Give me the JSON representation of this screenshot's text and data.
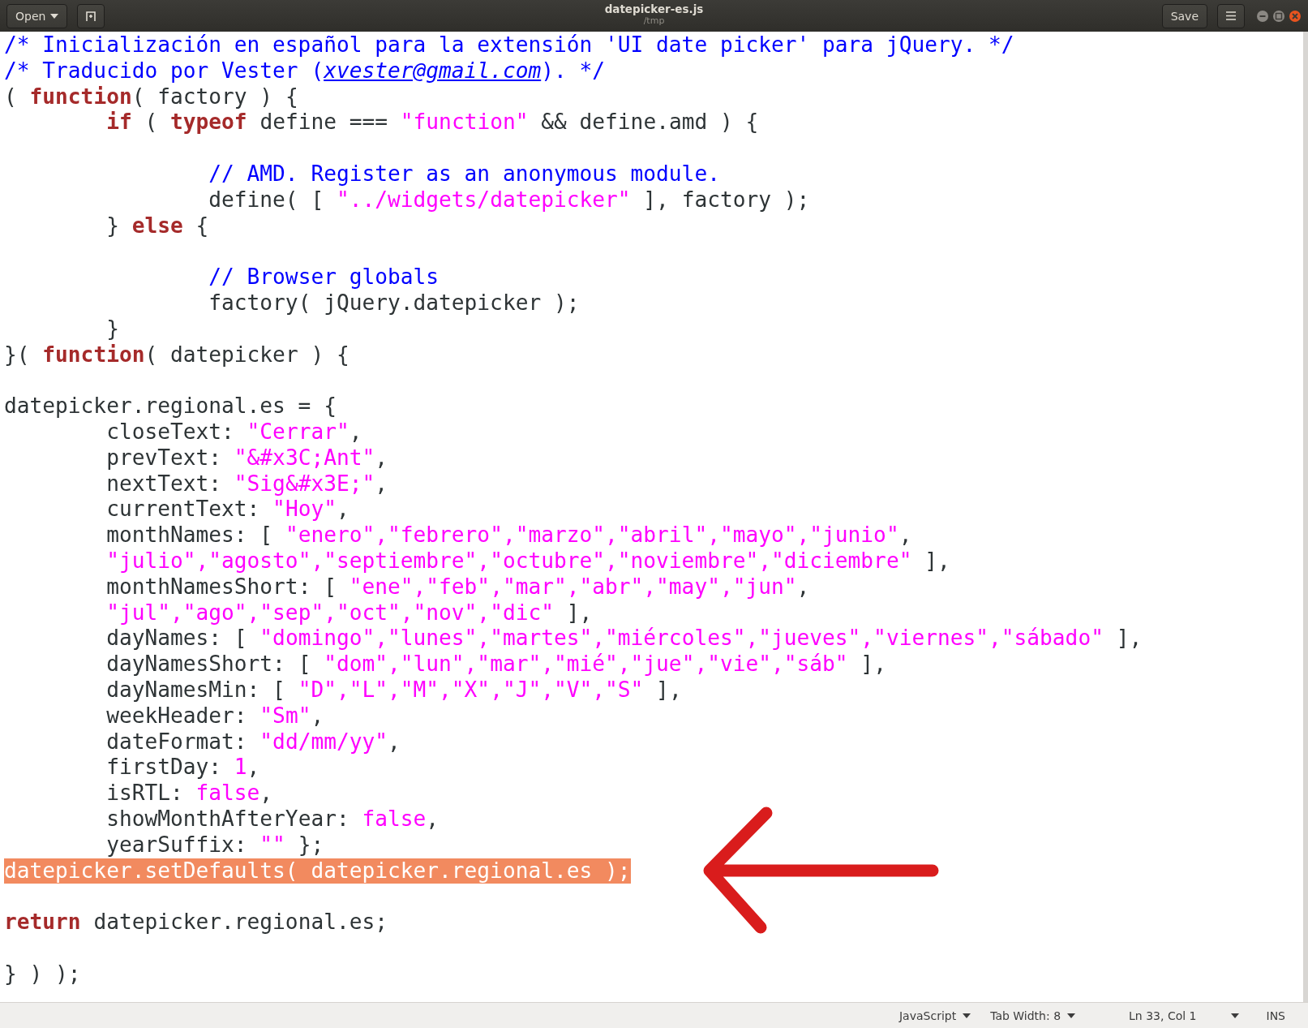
{
  "window": {
    "title": "datepicker-es.js",
    "subtitle": "/tmp"
  },
  "header": {
    "open_button": "Open",
    "save_button": "Save"
  },
  "lines": [
    {
      "selected": false,
      "segments": [
        {
          "kind": "comment",
          "text": "/* Inicialización en español para la extensión 'UI date picker' para jQuery. */"
        }
      ]
    },
    {
      "selected": false,
      "segments": [
        {
          "kind": "comment",
          "text": "/* Traducido por Vester ("
        },
        {
          "kind": "link",
          "text": "xvester@gmail.com"
        },
        {
          "kind": "comment",
          "text": "). */"
        }
      ]
    },
    {
      "selected": false,
      "segments": [
        {
          "kind": "plain",
          "text": "( "
        },
        {
          "kind": "keyword",
          "text": "function"
        },
        {
          "kind": "plain",
          "text": "( factory ) {"
        }
      ]
    },
    {
      "selected": false,
      "segments": [
        {
          "kind": "keyword",
          "text": "\tif"
        },
        {
          "kind": "plain",
          "text": " ( "
        },
        {
          "kind": "keyword",
          "text": "typeof"
        },
        {
          "kind": "plain",
          "text": " define === "
        },
        {
          "kind": "string",
          "text": "\"function\""
        },
        {
          "kind": "plain",
          "text": " && define.amd ) {"
        }
      ]
    },
    {
      "selected": false
    },
    {
      "selected": false,
      "segments": [
        {
          "kind": "comment",
          "text": "\t\t// AMD. Register as an anonymous module."
        }
      ]
    },
    {
      "selected": false,
      "segments": [
        {
          "kind": "plain",
          "text": "\t\tdefine( [ "
        },
        {
          "kind": "string",
          "text": "\"../widgets/datepicker\""
        },
        {
          "kind": "plain",
          "text": " ], factory );"
        }
      ]
    },
    {
      "selected": false,
      "segments": [
        {
          "kind": "plain",
          "text": "\t} "
        },
        {
          "kind": "keyword",
          "text": "else"
        },
        {
          "kind": "plain",
          "text": " {"
        }
      ]
    },
    {
      "selected": false
    },
    {
      "selected": false,
      "segments": [
        {
          "kind": "comment",
          "text": "\t\t// Browser globals"
        }
      ]
    },
    {
      "selected": false,
      "segments": [
        {
          "kind": "plain",
          "text": "\t\tfactory( jQuery.datepicker );"
        }
      ]
    },
    {
      "selected": false,
      "segments": [
        {
          "kind": "plain",
          "text": "\t}"
        }
      ]
    },
    {
      "selected": false,
      "segments": [
        {
          "kind": "plain",
          "text": "}( "
        },
        {
          "kind": "keyword",
          "text": "function"
        },
        {
          "kind": "plain",
          "text": "( datepicker ) {"
        }
      ]
    },
    {
      "selected": false
    },
    {
      "selected": false,
      "segments": [
        {
          "kind": "plain",
          "text": "datepicker.regional.es = {"
        }
      ]
    },
    {
      "selected": false,
      "segments": [
        {
          "kind": "plain",
          "text": "\tcloseText: "
        },
        {
          "kind": "string",
          "text": "\"Cerrar\""
        },
        {
          "kind": "plain",
          "text": ","
        }
      ]
    },
    {
      "selected": false,
      "segments": [
        {
          "kind": "plain",
          "text": "\tprevText: "
        },
        {
          "kind": "string",
          "text": "\"&#x3C;Ant\""
        },
        {
          "kind": "plain",
          "text": ","
        }
      ]
    },
    {
      "selected": false,
      "segments": [
        {
          "kind": "plain",
          "text": "\tnextText: "
        },
        {
          "kind": "string",
          "text": "\"Sig&#x3E;\""
        },
        {
          "kind": "plain",
          "text": ","
        }
      ]
    },
    {
      "selected": false,
      "segments": [
        {
          "kind": "plain",
          "text": "\tcurrentText: "
        },
        {
          "kind": "string",
          "text": "\"Hoy\""
        },
        {
          "kind": "plain",
          "text": ","
        }
      ]
    },
    {
      "selected": false,
      "segments": [
        {
          "kind": "plain",
          "text": "\tmonthNames: [ "
        },
        {
          "kind": "string",
          "text": "\"enero\",\"febrero\",\"marzo\",\"abril\",\"mayo\",\"junio\""
        },
        {
          "kind": "plain",
          "text": ","
        }
      ]
    },
    {
      "selected": false,
      "segments": [
        {
          "kind": "string",
          "text": "\t\"julio\",\"agosto\",\"septiembre\",\"octubre\",\"noviembre\",\"diciembre\""
        },
        {
          "kind": "plain",
          "text": " ],"
        }
      ]
    },
    {
      "selected": false,
      "segments": [
        {
          "kind": "plain",
          "text": "\tmonthNamesShort: [ "
        },
        {
          "kind": "string",
          "text": "\"ene\",\"feb\",\"mar\",\"abr\",\"may\",\"jun\""
        },
        {
          "kind": "plain",
          "text": ","
        }
      ]
    },
    {
      "selected": false,
      "segments": [
        {
          "kind": "string",
          "text": "\t\"jul\",\"ago\",\"sep\",\"oct\",\"nov\",\"dic\""
        },
        {
          "kind": "plain",
          "text": " ],"
        }
      ]
    },
    {
      "selected": false,
      "segments": [
        {
          "kind": "plain",
          "text": "\tdayNames: [ "
        },
        {
          "kind": "string",
          "text": "\"domingo\",\"lunes\",\"martes\",\"miércoles\",\"jueves\",\"viernes\",\"sábado\""
        },
        {
          "kind": "plain",
          "text": " ],"
        }
      ]
    },
    {
      "selected": false,
      "segments": [
        {
          "kind": "plain",
          "text": "\tdayNamesShort: [ "
        },
        {
          "kind": "string",
          "text": "\"dom\",\"lun\",\"mar\",\"mié\",\"jue\",\"vie\",\"sáb\""
        },
        {
          "kind": "plain",
          "text": " ],"
        }
      ]
    },
    {
      "selected": false,
      "segments": [
        {
          "kind": "plain",
          "text": "\tdayNamesMin: [ "
        },
        {
          "kind": "string",
          "text": "\"D\",\"L\",\"M\",\"X\",\"J\",\"V\",\"S\""
        },
        {
          "kind": "plain",
          "text": " ],"
        }
      ]
    },
    {
      "selected": false,
      "segments": [
        {
          "kind": "plain",
          "text": "\tweekHeader: "
        },
        {
          "kind": "string",
          "text": "\"Sm\""
        },
        {
          "kind": "plain",
          "text": ","
        }
      ]
    },
    {
      "selected": false,
      "segments": [
        {
          "kind": "plain",
          "text": "\tdateFormat: "
        },
        {
          "kind": "string",
          "text": "\"dd/mm/yy\""
        },
        {
          "kind": "plain",
          "text": ","
        }
      ]
    },
    {
      "selected": false,
      "segments": [
        {
          "kind": "plain",
          "text": "\tfirstDay: "
        },
        {
          "kind": "number",
          "text": "1"
        },
        {
          "kind": "plain",
          "text": ","
        }
      ]
    },
    {
      "selected": false,
      "segments": [
        {
          "kind": "plain",
          "text": "\tisRTL: "
        },
        {
          "kind": "constant",
          "text": "false"
        },
        {
          "kind": "plain",
          "text": ","
        }
      ]
    },
    {
      "selected": false,
      "segments": [
        {
          "kind": "plain",
          "text": "\tshowMonthAfterYear: "
        },
        {
          "kind": "constant",
          "text": "false"
        },
        {
          "kind": "plain",
          "text": ","
        }
      ]
    },
    {
      "selected": false,
      "segments": [
        {
          "kind": "plain",
          "text": "\tyearSuffix: "
        },
        {
          "kind": "string",
          "text": "\"\""
        },
        {
          "kind": "plain",
          "text": " };"
        }
      ]
    },
    {
      "selected": true,
      "segments": [
        {
          "kind": "plain",
          "text": "datepicker.setDefaults( datepicker.regional.es );"
        }
      ]
    },
    {
      "selected": false
    },
    {
      "selected": false,
      "segments": [
        {
          "kind": "keyword",
          "text": "return"
        },
        {
          "kind": "plain",
          "text": " datepicker.regional.es;"
        }
      ]
    },
    {
      "selected": false
    },
    {
      "selected": false,
      "segments": [
        {
          "kind": "plain",
          "text": "} ) );"
        }
      ]
    }
  ],
  "status_bar": {
    "language": "JavaScript",
    "tab_width": "Tab Width: 8",
    "position": "Ln 33, Col 1",
    "mode": "INS"
  }
}
